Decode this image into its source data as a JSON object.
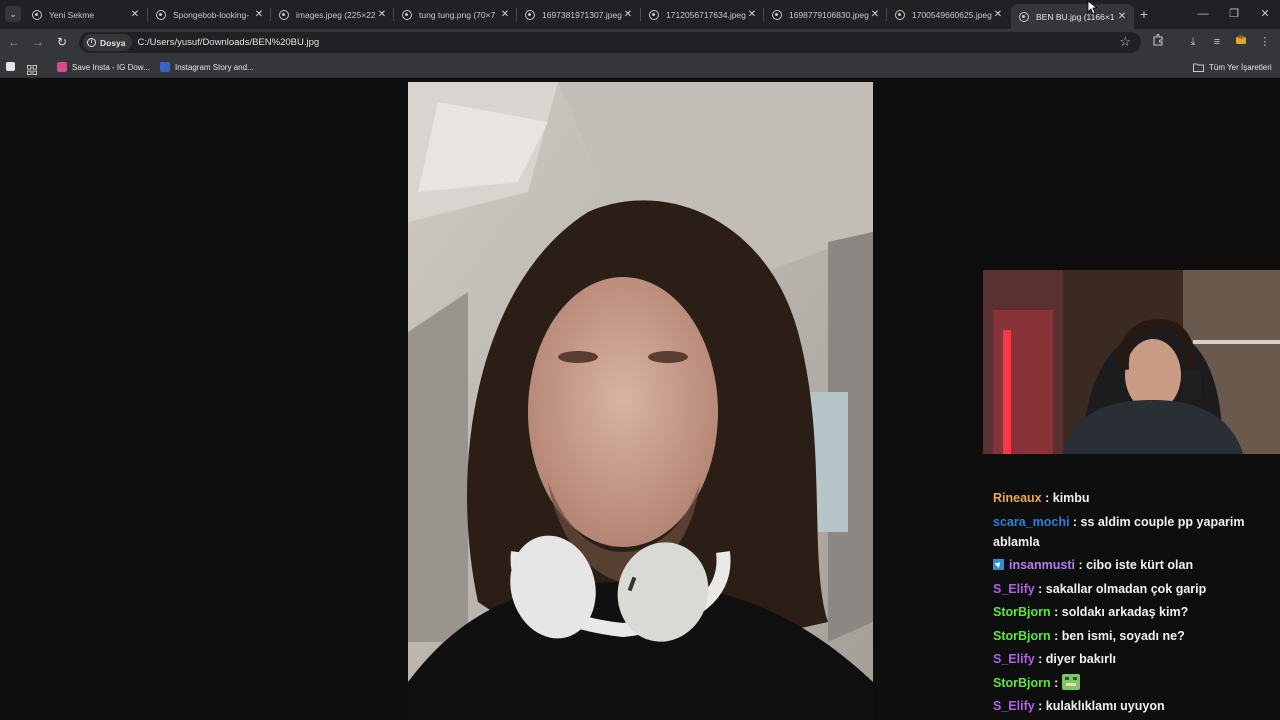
{
  "tabs": [
    {
      "label": "Yeni Sekme"
    },
    {
      "label": "Spongebob-looking-"
    },
    {
      "label": "images.jpeg (225×22"
    },
    {
      "label": "tung tung.png (70×7"
    },
    {
      "label": "1697381971307.jpeg"
    },
    {
      "label": "1712056717634.jpeg"
    },
    {
      "label": "1698779106830.jpeg"
    },
    {
      "label": "1700549660625.jpeg"
    },
    {
      "label": "BEN BU.jpg (1166×1"
    }
  ],
  "active_tab_index": 8,
  "address": {
    "chip_label": "Dosya",
    "url": "C:/Users/yusuf/Downloads/BEN%20BU.jpg"
  },
  "bookmarks": {
    "items": [
      {
        "label": "Save Insta - IG Dow..."
      },
      {
        "label": "Instagram Story and..."
      }
    ],
    "all_label": "Tüm Yer İşaretleri"
  },
  "chat": {
    "messages": [
      {
        "user": "Rineaux",
        "color": "#f0a64a",
        "text": "kimbu",
        "badge": false,
        "emote": false
      },
      {
        "user": "scara_mochi",
        "color": "#2e7fd8",
        "text": "ss aldim couple pp yaparim ablamla",
        "badge": false,
        "emote": false
      },
      {
        "user": "insanmusti",
        "color": "#b37ff0",
        "text": "cibo iste kürt olan",
        "badge": true,
        "emote": false
      },
      {
        "user": "S_Elify",
        "color": "#b05fe6",
        "text": "sakallar olmadan çok garip",
        "badge": false,
        "emote": false
      },
      {
        "user": "StorBjorn",
        "color": "#5ce63d",
        "text": "soldakı arkadaş kim?",
        "badge": false,
        "emote": false
      },
      {
        "user": "StorBjorn",
        "color": "#5ce63d",
        "text": "ben ismi, soyadı ne?",
        "badge": false,
        "emote": false
      },
      {
        "user": "S_Elify",
        "color": "#b05fe6",
        "text": "diyer bakırlı",
        "badge": false,
        "emote": false
      },
      {
        "user": "StorBjorn",
        "color": "#5ce63d",
        "text": "",
        "badge": false,
        "emote": true
      },
      {
        "user": "S_Elify",
        "color": "#b05fe6",
        "text": "kulaklıklamı uyuyon",
        "badge": false,
        "emote": false
      }
    ]
  },
  "colors": {
    "tab_strip": "#202124",
    "toolbar": "#35363a",
    "viewer_bg": "#0e0e0e"
  }
}
